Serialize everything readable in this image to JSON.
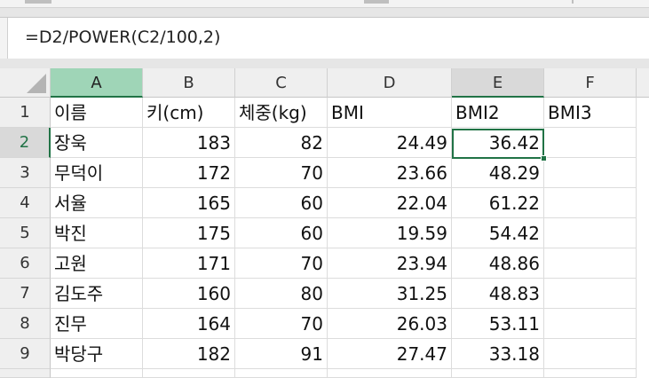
{
  "formula_bar": {
    "formula": "=D2/POWER(C2/100,2)"
  },
  "grid": {
    "columns": [
      "A",
      "B",
      "C",
      "D",
      "E",
      "F"
    ],
    "rows": [
      "1",
      "2",
      "3",
      "4",
      "5",
      "6",
      "7",
      "8",
      "9"
    ],
    "cells": [
      [
        "이름",
        "키(cm)",
        "체중(kg)",
        "BMI",
        "BMI2",
        "BMI3"
      ],
      [
        "장욱",
        "183",
        "82",
        "24.49",
        "36.42",
        ""
      ],
      [
        "무덕이",
        "172",
        "70",
        "23.66",
        "48.29",
        ""
      ],
      [
        "서율",
        "165",
        "60",
        "22.04",
        "61.22",
        ""
      ],
      [
        "박진",
        "175",
        "60",
        "19.59",
        "54.42",
        ""
      ],
      [
        "고원",
        "171",
        "70",
        "23.94",
        "48.86",
        ""
      ],
      [
        "김도주",
        "160",
        "80",
        "31.25",
        "48.83",
        ""
      ],
      [
        "진무",
        "164",
        "70",
        "26.03",
        "53.11",
        ""
      ],
      [
        "박당구",
        "182",
        "91",
        "27.47",
        "33.18",
        ""
      ]
    ],
    "active_cell": "E2",
    "selected_column_highlight": "A",
    "accent_color": "#217346"
  }
}
